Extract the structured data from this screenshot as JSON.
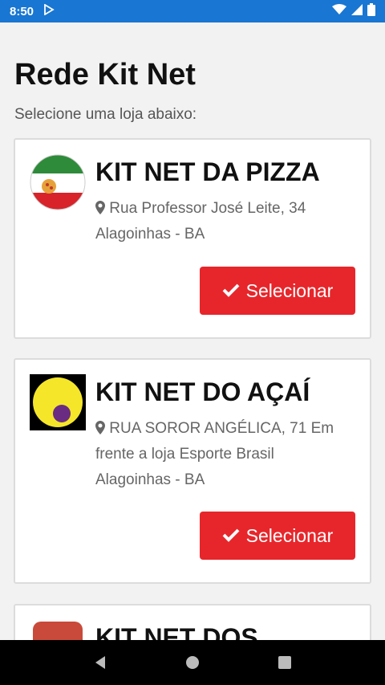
{
  "status": {
    "time": "8:50"
  },
  "page": {
    "title": "Rede Kit Net",
    "subtitle": "Selecione uma loja abaixo:"
  },
  "stores": [
    {
      "name": "KIT NET DA PIZZA",
      "address_lines": [
        "Rua Professor José Leite, 34",
        "Alagoinhas - BA"
      ],
      "button_label": "Selecionar"
    },
    {
      "name": "KIT NET DO AÇAÍ",
      "address_lines": [
        "RUA SOROR ANGÉLICA, 71 Em",
        "frente a loja Esporte Brasil",
        "Alagoinhas - BA"
      ],
      "button_label": "Selecionar"
    },
    {
      "name": "KIT NET DOS"
    }
  ],
  "colors": {
    "status_bar": "#1976d2",
    "button": "#e7262b",
    "background": "#f2f2f2"
  },
  "icons": {
    "location": "map-marker-icon",
    "check": "check-icon"
  }
}
